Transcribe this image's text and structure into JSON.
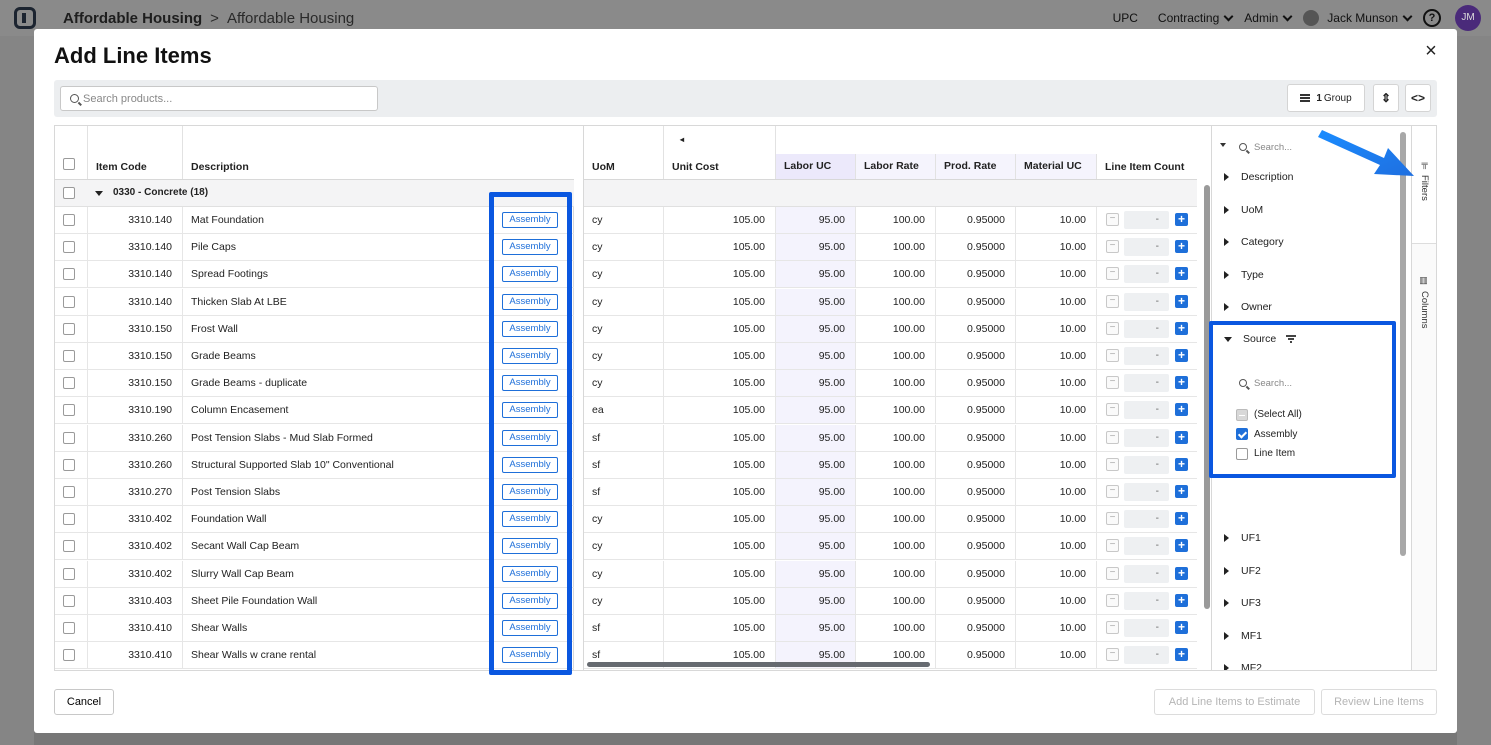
{
  "app": {
    "breadcrumb_root": "Affordable Housing",
    "breadcrumb_sep": ">",
    "breadcrumb_current": "Affordable Housing",
    "nav": [
      "UPC",
      "Contracting",
      "Admin"
    ],
    "user_name": "Jack Munson",
    "avatar_initials": "JM",
    "help": "?"
  },
  "modal": {
    "title": "Add Line Items",
    "close": "×"
  },
  "toolbar": {
    "search_placeholder": "Search products...",
    "group_count": "1",
    "group_label": "Group",
    "expand_icon": "expand-collapse-icon",
    "code_icon": "code-view-icon"
  },
  "grid": {
    "columns_left": [
      "Item Code",
      "Description"
    ],
    "columns_right": [
      "UoM",
      "Unit Cost",
      "Labor UC",
      "Labor Rate",
      "Prod. Rate",
      "Material UC",
      "Line Item Count"
    ],
    "group_row": "0330 - Concrete (18)",
    "rows": [
      {
        "code": "3310.140",
        "desc": "Mat Foundation",
        "source": "Assembly",
        "uom": "cy",
        "unit_cost": "105.00",
        "labor_uc": "95.00",
        "labor_rate": "100.00",
        "prod_rate": "0.95000",
        "material_uc": "10.00",
        "count": "-"
      },
      {
        "code": "3310.140",
        "desc": "Pile Caps",
        "source": "Assembly",
        "uom": "cy",
        "unit_cost": "105.00",
        "labor_uc": "95.00",
        "labor_rate": "100.00",
        "prod_rate": "0.95000",
        "material_uc": "10.00",
        "count": "-"
      },
      {
        "code": "3310.140",
        "desc": "Spread Footings",
        "source": "Assembly",
        "uom": "cy",
        "unit_cost": "105.00",
        "labor_uc": "95.00",
        "labor_rate": "100.00",
        "prod_rate": "0.95000",
        "material_uc": "10.00",
        "count": "-"
      },
      {
        "code": "3310.140",
        "desc": "Thicken Slab At LBE",
        "source": "Assembly",
        "uom": "cy",
        "unit_cost": "105.00",
        "labor_uc": "95.00",
        "labor_rate": "100.00",
        "prod_rate": "0.95000",
        "material_uc": "10.00",
        "count": "-"
      },
      {
        "code": "3310.150",
        "desc": "Frost Wall",
        "source": "Assembly",
        "uom": "cy",
        "unit_cost": "105.00",
        "labor_uc": "95.00",
        "labor_rate": "100.00",
        "prod_rate": "0.95000",
        "material_uc": "10.00",
        "count": "-"
      },
      {
        "code": "3310.150",
        "desc": "Grade Beams",
        "source": "Assembly",
        "uom": "cy",
        "unit_cost": "105.00",
        "labor_uc": "95.00",
        "labor_rate": "100.00",
        "prod_rate": "0.95000",
        "material_uc": "10.00",
        "count": "-"
      },
      {
        "code": "3310.150",
        "desc": "Grade Beams - duplicate",
        "source": "Assembly",
        "uom": "cy",
        "unit_cost": "105.00",
        "labor_uc": "95.00",
        "labor_rate": "100.00",
        "prod_rate": "0.95000",
        "material_uc": "10.00",
        "count": "-"
      },
      {
        "code": "3310.190",
        "desc": "Column Encasement",
        "source": "Assembly",
        "uom": "ea",
        "unit_cost": "105.00",
        "labor_uc": "95.00",
        "labor_rate": "100.00",
        "prod_rate": "0.95000",
        "material_uc": "10.00",
        "count": "-"
      },
      {
        "code": "3310.260",
        "desc": "Post Tension Slabs - Mud Slab Formed",
        "source": "Assembly",
        "uom": "sf",
        "unit_cost": "105.00",
        "labor_uc": "95.00",
        "labor_rate": "100.00",
        "prod_rate": "0.95000",
        "material_uc": "10.00",
        "count": "-"
      },
      {
        "code": "3310.260",
        "desc": "Structural Supported Slab 10\" Conventional",
        "source": "Assembly",
        "uom": "sf",
        "unit_cost": "105.00",
        "labor_uc": "95.00",
        "labor_rate": "100.00",
        "prod_rate": "0.95000",
        "material_uc": "10.00",
        "count": "-"
      },
      {
        "code": "3310.270",
        "desc": "Post Tension Slabs",
        "source": "Assembly",
        "uom": "sf",
        "unit_cost": "105.00",
        "labor_uc": "95.00",
        "labor_rate": "100.00",
        "prod_rate": "0.95000",
        "material_uc": "10.00",
        "count": "-"
      },
      {
        "code": "3310.402",
        "desc": "Foundation Wall",
        "source": "Assembly",
        "uom": "cy",
        "unit_cost": "105.00",
        "labor_uc": "95.00",
        "labor_rate": "100.00",
        "prod_rate": "0.95000",
        "material_uc": "10.00",
        "count": "-"
      },
      {
        "code": "3310.402",
        "desc": "Secant Wall Cap Beam",
        "source": "Assembly",
        "uom": "cy",
        "unit_cost": "105.00",
        "labor_uc": "95.00",
        "labor_rate": "100.00",
        "prod_rate": "0.95000",
        "material_uc": "10.00",
        "count": "-"
      },
      {
        "code": "3310.402",
        "desc": "Slurry Wall Cap Beam",
        "source": "Assembly",
        "uom": "cy",
        "unit_cost": "105.00",
        "labor_uc": "95.00",
        "labor_rate": "100.00",
        "prod_rate": "0.95000",
        "material_uc": "10.00",
        "count": "-"
      },
      {
        "code": "3310.403",
        "desc": "Sheet Pile Foundation Wall",
        "source": "Assembly",
        "uom": "cy",
        "unit_cost": "105.00",
        "labor_uc": "95.00",
        "labor_rate": "100.00",
        "prod_rate": "0.95000",
        "material_uc": "10.00",
        "count": "-"
      },
      {
        "code": "3310.410",
        "desc": "Shear Walls",
        "source": "Assembly",
        "uom": "sf",
        "unit_cost": "105.00",
        "labor_uc": "95.00",
        "labor_rate": "100.00",
        "prod_rate": "0.95000",
        "material_uc": "10.00",
        "count": "-"
      },
      {
        "code": "3310.410",
        "desc": "Shear Walls w crane rental",
        "source": "Assembly",
        "uom": "sf",
        "unit_cost": "105.00",
        "labor_uc": "95.00",
        "labor_rate": "100.00",
        "prod_rate": "0.95000",
        "material_uc": "10.00",
        "count": "-"
      }
    ]
  },
  "filters": {
    "search_placeholder": "Search...",
    "items_top": [
      "Description",
      "UoM",
      "Category",
      "Type",
      "Owner"
    ],
    "source": {
      "label": "Source",
      "search_placeholder": "Search...",
      "options": [
        {
          "label": "(Select All)",
          "state": "indeterminate"
        },
        {
          "label": "Assembly",
          "state": "checked"
        },
        {
          "label": "Line Item",
          "state": "unchecked"
        }
      ]
    },
    "items_bottom": [
      "UF1",
      "UF2",
      "UF3",
      "MF1",
      "MF2"
    ],
    "tab_filters": "Filters",
    "tab_columns": "Columns"
  },
  "footer": {
    "cancel": "Cancel",
    "add": "Add Line Items to Estimate",
    "review": "Review Line Items"
  },
  "colors": {
    "accent": "#1e6fd9",
    "highlight": "#0a57e0",
    "labor_col": "#ece9fb"
  }
}
